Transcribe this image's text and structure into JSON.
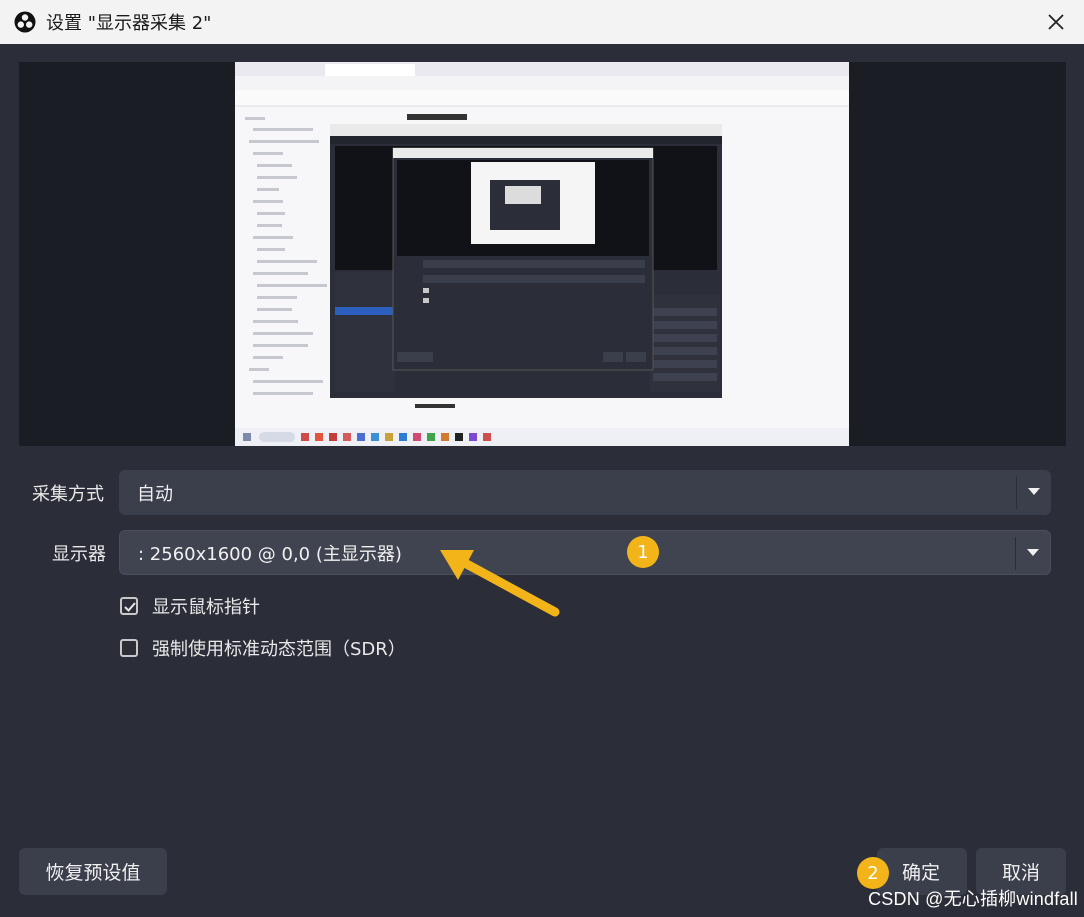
{
  "window": {
    "title": "设置 \"显示器采集 2\"",
    "close_icon": "close-icon",
    "logo_icon": "obs-logo-icon"
  },
  "preview": {
    "description_icon": "screen-capture-preview"
  },
  "capture_method": {
    "label": "采集方式",
    "value": "自动"
  },
  "display": {
    "label": "显示器",
    "value": ": 2560x1600 @ 0,0 (主显示器)"
  },
  "options": {
    "show_cursor": {
      "label": "显示鼠标指针",
      "checked": true
    },
    "force_sdr": {
      "label": "强制使用标准动态范围（SDR）",
      "checked": false
    }
  },
  "buttons": {
    "restore_defaults": "恢复预设值",
    "ok": "确定",
    "cancel": "取消"
  },
  "annotations": {
    "badge_1": "1",
    "badge_2": "2",
    "accent_color": "#f2b418"
  },
  "watermark": "CSDN @无心插柳windfall"
}
